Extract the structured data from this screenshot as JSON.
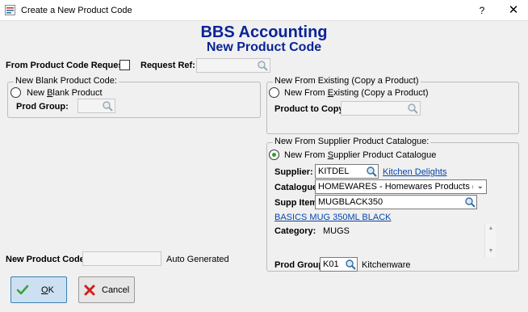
{
  "window": {
    "title": "Create a New Product Code",
    "help_label": "?",
    "close_label": "✕"
  },
  "heading": {
    "line1": "BBS Accounting",
    "line2": "New Product Code",
    "color": "#0a2396"
  },
  "request": {
    "from_label": "From Product Code Request:",
    "ref_label": "Request Ref:",
    "ref_value": ""
  },
  "blank_group": {
    "title": "New Blank Product Code:",
    "option_prefix": "New ",
    "option_accel": "B",
    "option_rest": "lank Product",
    "selected": false,
    "prod_group_label": "Prod Group:",
    "prod_group_value": ""
  },
  "existing_group": {
    "title": "New From Existing (Copy a Product)",
    "option_prefix": "New From ",
    "option_accel": "E",
    "option_rest": "xisting (Copy a Product)",
    "selected": false,
    "copy_label": "Product to Copy:",
    "copy_value": ""
  },
  "supplier_group": {
    "title": "New From Supplier Product Catalogue:",
    "option_prefix": "New From ",
    "option_accel": "S",
    "option_rest": "upplier Product Catalogue",
    "selected": true,
    "supplier_label": "Supplier:",
    "supplier_value": "KITDEL",
    "supplier_name": "Kitchen Delights",
    "catalogue_label": "Catalogue:",
    "catalogue_value": "HOMEWARES  - Homewares Products (impo",
    "supp_item_label": "Supp Item:",
    "supp_item_value": "MUGBLACK350",
    "item_description": "BASICS MUG 350ML BLACK",
    "category_label": "Category:",
    "category_value": "MUGS",
    "prod_group_label": "Prod Group:",
    "prod_group_value": "K01",
    "prod_group_name": "Kitchenware"
  },
  "new_code": {
    "label": "New Product Code:",
    "value": "",
    "note": "Auto Generated"
  },
  "buttons": {
    "ok_label": "OK",
    "ok_accel": "O",
    "ok_rest": "K",
    "cancel_label": "Cancel"
  },
  "colors": {
    "link": "#0645ad",
    "radio_selected": "#2aa02a",
    "ok_focus": "#cde0f2"
  }
}
